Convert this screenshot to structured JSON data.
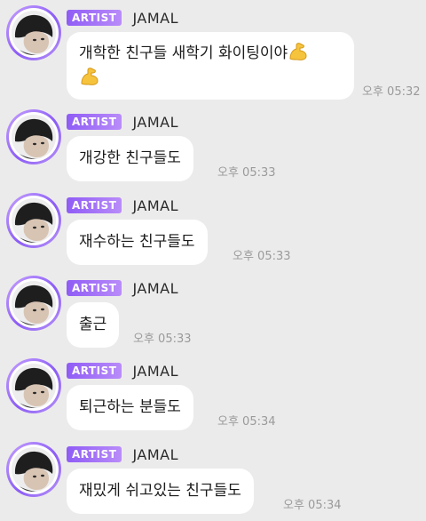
{
  "badge_label": "ARTIST",
  "sender_name": "JAMAL",
  "colors": {
    "background": "#ecebeb",
    "bubble": "#ffffff",
    "badge_start": "#8f5cf5",
    "badge_end": "#b98cf9",
    "time_text": "#9a9a9a"
  },
  "messages": [
    {
      "text": "개학한 친구들 새학기 화이팅이야",
      "text_line2": "",
      "emoji": "flexed-biceps-icon",
      "time": "오후 05:32"
    },
    {
      "text": "개강한 친구들도",
      "time": "오후 05:33"
    },
    {
      "text": "재수하는 친구들도",
      "time": "오후 05:33"
    },
    {
      "text": "출근",
      "time": "오후 05:33"
    },
    {
      "text": "퇴근하는 분들도",
      "time": "오후 05:34"
    },
    {
      "text": "재밌게 쉬고있는 친구들도",
      "time": "오후 05:34"
    }
  ]
}
